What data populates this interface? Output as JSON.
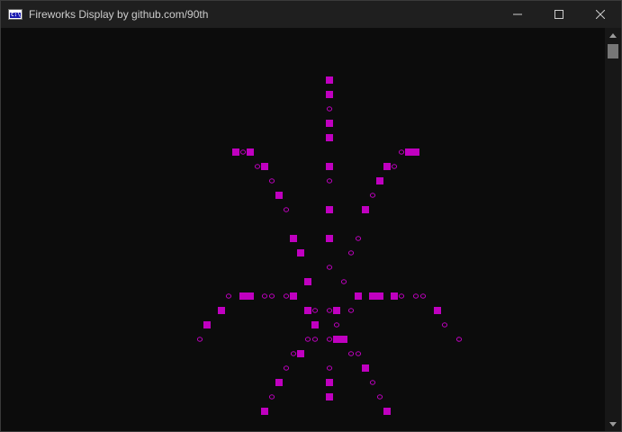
{
  "window": {
    "title": "Fireworks Display by github.com/90th",
    "icon": "console-icon"
  },
  "title_bar_buttons": [
    "minimize-icon",
    "maximize-icon",
    "close-icon"
  ],
  "colors": {
    "background": "#0c0c0c",
    "titlebar": "#1f1f1f",
    "firework": "#c000c0",
    "title_text": "#cccccc"
  },
  "firework": {
    "symbols": {
      "block": "■",
      "ring": "o"
    }
  }
}
